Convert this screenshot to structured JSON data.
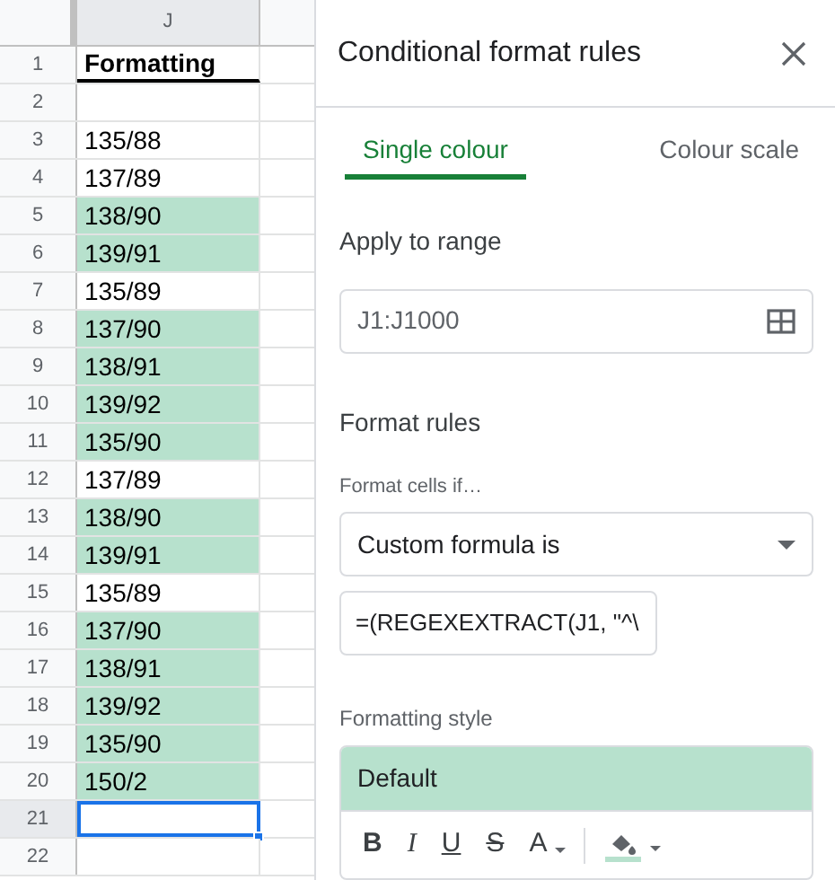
{
  "sheet": {
    "column_header": "J",
    "rows": [
      {
        "number": "1",
        "value": "Formatting",
        "kind": "header",
        "highlighted": false,
        "selected": false
      },
      {
        "number": "2",
        "value": "",
        "kind": "value",
        "highlighted": false,
        "selected": false
      },
      {
        "number": "3",
        "value": "135/88",
        "kind": "value",
        "highlighted": false,
        "selected": false
      },
      {
        "number": "4",
        "value": "137/89",
        "kind": "value",
        "highlighted": false,
        "selected": false
      },
      {
        "number": "5",
        "value": "138/90",
        "kind": "value",
        "highlighted": true,
        "selected": false
      },
      {
        "number": "6",
        "value": "139/91",
        "kind": "value",
        "highlighted": true,
        "selected": false
      },
      {
        "number": "7",
        "value": "135/89",
        "kind": "value",
        "highlighted": false,
        "selected": false
      },
      {
        "number": "8",
        "value": "137/90",
        "kind": "value",
        "highlighted": true,
        "selected": false
      },
      {
        "number": "9",
        "value": "138/91",
        "kind": "value",
        "highlighted": true,
        "selected": false
      },
      {
        "number": "10",
        "value": "139/92",
        "kind": "value",
        "highlighted": true,
        "selected": false
      },
      {
        "number": "11",
        "value": "135/90",
        "kind": "value",
        "highlighted": true,
        "selected": false
      },
      {
        "number": "12",
        "value": "137/89",
        "kind": "value",
        "highlighted": false,
        "selected": false
      },
      {
        "number": "13",
        "value": "138/90",
        "kind": "value",
        "highlighted": true,
        "selected": false
      },
      {
        "number": "14",
        "value": "139/91",
        "kind": "value",
        "highlighted": true,
        "selected": false
      },
      {
        "number": "15",
        "value": "135/89",
        "kind": "value",
        "highlighted": false,
        "selected": false
      },
      {
        "number": "16",
        "value": "137/90",
        "kind": "value",
        "highlighted": true,
        "selected": false
      },
      {
        "number": "17",
        "value": "138/91",
        "kind": "value",
        "highlighted": true,
        "selected": false
      },
      {
        "number": "18",
        "value": "139/92",
        "kind": "value",
        "highlighted": true,
        "selected": false
      },
      {
        "number": "19",
        "value": "135/90",
        "kind": "value",
        "highlighted": true,
        "selected": false
      },
      {
        "number": "20",
        "value": "150/2",
        "kind": "value",
        "highlighted": true,
        "selected": false
      },
      {
        "number": "21",
        "value": "",
        "kind": "value",
        "highlighted": false,
        "selected": true
      },
      {
        "number": "22",
        "value": "",
        "kind": "value",
        "highlighted": false,
        "selected": false
      }
    ]
  },
  "panel": {
    "title": "Conditional format rules",
    "tabs": [
      {
        "label": "Single colour",
        "selected": true
      },
      {
        "label": "Colour scale",
        "selected": false
      }
    ],
    "range_label": "Apply to range",
    "range_value": "J1:J1000",
    "rules_heading": "Format rules",
    "condition_label": "Format cells if…",
    "condition": "Custom formula is",
    "formula": "=(REGEXEXTRACT(J1, \"^\\",
    "style_label": "Formatting style",
    "style_preview": "Default",
    "style_buttons": [
      {
        "label": "B",
        "kind": "bold"
      },
      {
        "label": "I",
        "kind": "italic"
      },
      {
        "label": "U",
        "kind": "underline"
      },
      {
        "label": "S",
        "kind": "strike"
      },
      {
        "label": "A",
        "kind": "text-color"
      }
    ]
  }
}
